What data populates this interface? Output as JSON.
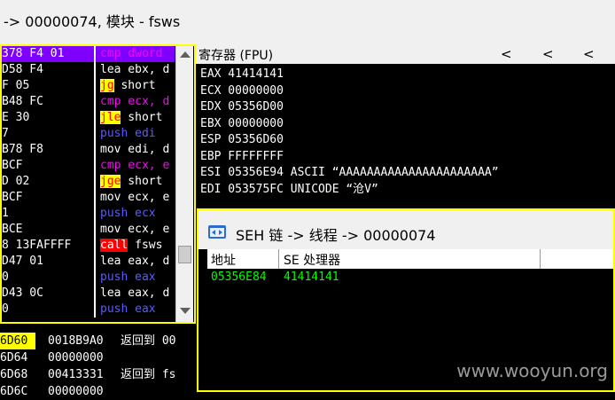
{
  "window": {
    "title": "-> 00000074, 模块 - fsws"
  },
  "disasm": {
    "rows": [
      {
        "addr": "378 F4 01",
        "mnem": "cmp dword",
        "style": "c-mag",
        "selected": true
      },
      {
        "addr": "D58 F4",
        "mnem": "lea ebx, d",
        "style": "c-wht"
      },
      {
        "addr": "F 05",
        "op": "jg",
        "rest": " short",
        "style": "jmp"
      },
      {
        "addr": "B48 FC",
        "mnem": "cmp ecx, d",
        "style": "c-mag"
      },
      {
        "addr": "E 30",
        "op": "jle",
        "rest": " short",
        "style": "jmp"
      },
      {
        "addr": "7",
        "mnem": "push edi",
        "style": "c-blu"
      },
      {
        "addr": "B78 F8",
        "mnem": "mov edi, d",
        "style": "c-wht"
      },
      {
        "addr": "BCF",
        "mnem": "cmp ecx, e",
        "style": "c-mag"
      },
      {
        "addr": "D 02",
        "op": "jge",
        "rest": " short",
        "style": "jmp"
      },
      {
        "addr": "BCF",
        "mnem": "mov ecx, e",
        "style": "c-wht"
      },
      {
        "addr": "1",
        "mnem": "push ecx",
        "style": "c-blu"
      },
      {
        "addr": "BCE",
        "mnem": "mov ecx, e",
        "style": "c-wht"
      },
      {
        "addr": "8 13FAFFFF",
        "op": "call",
        "rest": " fsws",
        "style": "call"
      },
      {
        "addr": "D47 01",
        "mnem": "lea eax, d",
        "style": "c-wht"
      },
      {
        "addr": "0",
        "mnem": "push eax",
        "style": "c-blu"
      },
      {
        "addr": "D43 0C",
        "mnem": "lea eax, d",
        "style": "c-wht"
      },
      {
        "addr": "0",
        "mnem": "push eax",
        "style": "c-blu"
      }
    ]
  },
  "registers": {
    "header": "寄存器 (FPU)",
    "nav": [
      "<",
      "<",
      "<"
    ],
    "lines": [
      "EAX 41414141",
      "ECX 00000000",
      "EDX 05356D00",
      "EBX 00000000",
      "ESP 05356D60",
      "EBP FFFFFFFF",
      "ESI 05356E94 ASCII “AAAAAAAAAAAAAAAAAAAAAA”",
      "EDI 053575FC UNICODE “沧V”"
    ]
  },
  "stack": {
    "rows": [
      {
        "addr": "6D60",
        "val": "0018B9A0",
        "cmt": "返回到 00"
      },
      {
        "addr": "6D64",
        "val": "00000000",
        "cmt": ""
      },
      {
        "addr": "6D68",
        "val": "00413331",
        "cmt": "返回到 fs"
      },
      {
        "addr": "6D6C",
        "val": "00000000",
        "cmt": ""
      }
    ]
  },
  "seh": {
    "title": "SEH 链 -> 线程 -> 00000074",
    "col_address": "地址",
    "col_handler": "SE 处理器",
    "rows": [
      {
        "address": "05356E84",
        "handler": "41414141"
      }
    ]
  },
  "watermark": "www.wooyun.org"
}
